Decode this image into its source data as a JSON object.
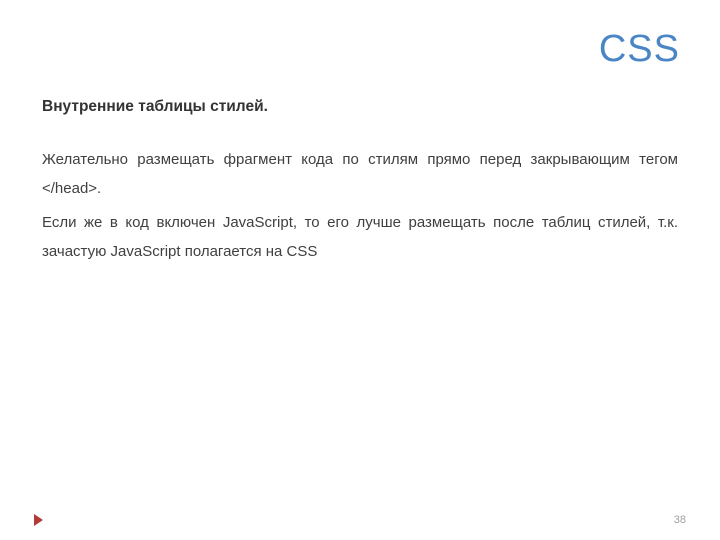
{
  "title": "CSS",
  "subheading": "Внутренние таблицы стилей.",
  "paragraphs": [
    "Желательно размещать фрагмент кода по стилям прямо перед закрывающим тегом </head>.",
    "Если же в код включен JavaScript, то его лучше размещать после таблиц стилей, т.к. зачастую JavaScript полагается на CSS"
  ],
  "page_number": "38"
}
